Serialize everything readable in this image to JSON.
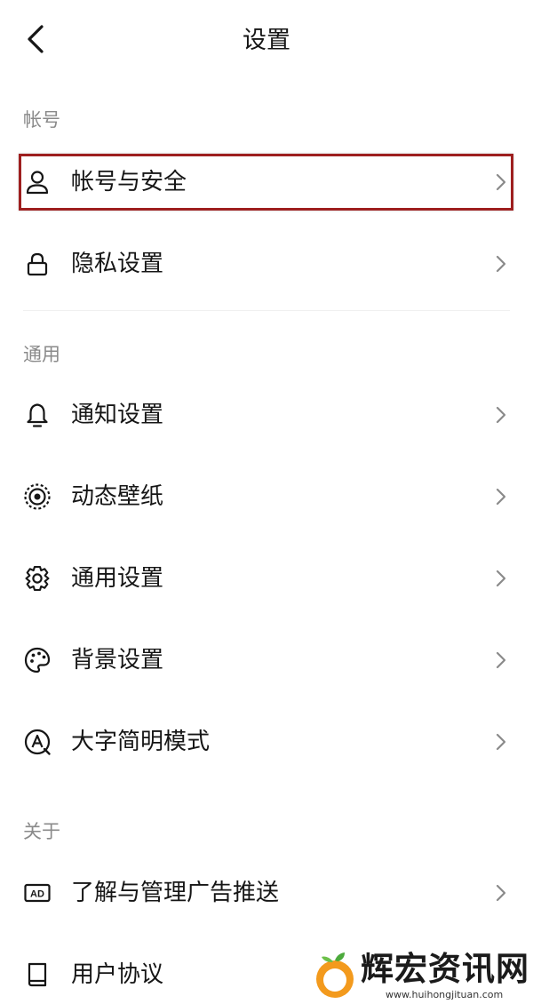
{
  "header": {
    "title": "设置",
    "back_icon": "chevron-left-icon"
  },
  "sections": [
    {
      "header": "帐号",
      "items": [
        {
          "label": "帐号与安全",
          "icon": "person-icon",
          "highlighted": true
        },
        {
          "label": "隐私设置",
          "icon": "lock-icon"
        }
      ]
    },
    {
      "header": "通用",
      "items": [
        {
          "label": "通知设置",
          "icon": "bell-icon"
        },
        {
          "label": "动态壁纸",
          "icon": "wallpaper-icon"
        },
        {
          "label": "通用设置",
          "icon": "gear-icon"
        },
        {
          "label": "背景设置",
          "icon": "palette-icon"
        },
        {
          "label": "大字简明模式",
          "icon": "large-font-icon"
        }
      ]
    },
    {
      "header": "关于",
      "items": [
        {
          "label": "了解与管理广告推送",
          "icon": "ad-icon"
        },
        {
          "label": "用户协议",
          "icon": "book-icon"
        }
      ]
    }
  ],
  "highlight_color": "#9e1f1f",
  "watermark": {
    "text": "辉宏资讯网",
    "url": "www.huihongjituan.com"
  }
}
